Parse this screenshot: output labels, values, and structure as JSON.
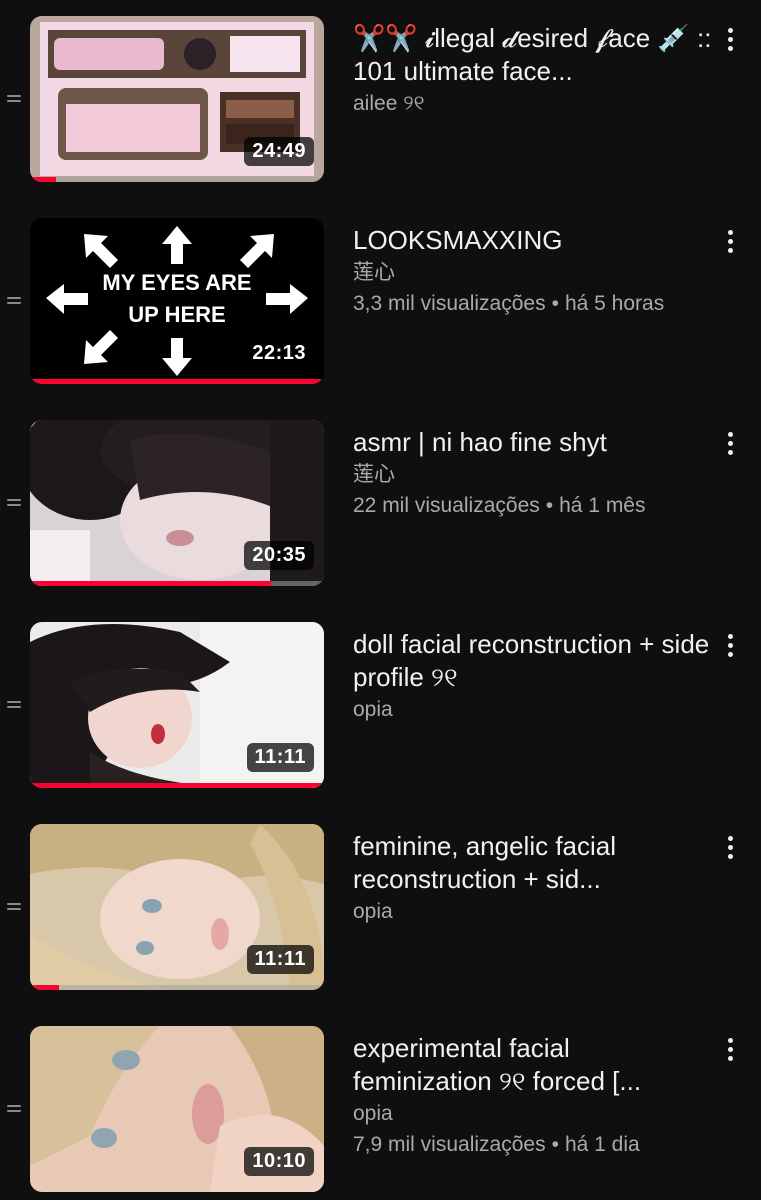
{
  "videos": [
    {
      "title": "✂️✂️ 𝓲llegal 𝓭esired 𝓯ace 💉 :: 101 ultimate face...",
      "channel": "ailee ୨୧",
      "views": "",
      "age": "",
      "duration": "24:49",
      "progress": 0.09,
      "thumb_icon": "misstada-screenshot-thumbnail"
    },
    {
      "title": "LOOKSMAXXING",
      "channel": "莲心",
      "views": "3,3 mil visualizações",
      "age": "há 5 horas",
      "duration": "22:13",
      "progress": 1.0,
      "thumb_text_1": "MY EYES ARE",
      "thumb_text_2": "UP HERE",
      "thumb_icon": "arrows-thumbnail"
    },
    {
      "title": "asmr | ni hao fine shyt",
      "channel": "莲心",
      "views": "22 mil visualizações",
      "age": "há 1 mês",
      "duration": "20:35",
      "progress": 0.82,
      "thumb_icon": "anime-girl-thumbnail"
    },
    {
      "title": "doll facial reconstruction + side profile ୨୧",
      "channel": "opia",
      "views": "",
      "age": "",
      "duration": "11:11",
      "progress": 1.0,
      "thumb_icon": "dark-hair-portrait-thumbnail"
    },
    {
      "title": "feminine, angelic facial reconstruction + sid...",
      "channel": "opia",
      "views": "",
      "age": "",
      "duration": "11:11",
      "progress": 0.1,
      "thumb_icon": "blonde-portrait-thumbnail"
    },
    {
      "title": "experimental facial feminization ୨୧ forced [...",
      "channel": "opia",
      "views": "7,9 mil visualizações",
      "age": "há 1 dia",
      "duration": "10:10",
      "progress": 0,
      "thumb_icon": "blonde-closeup-thumbnail"
    }
  ],
  "colors": {
    "background": "#0f0f0f",
    "progress": "#ff0033",
    "secondary_text": "#aaaaaa"
  }
}
